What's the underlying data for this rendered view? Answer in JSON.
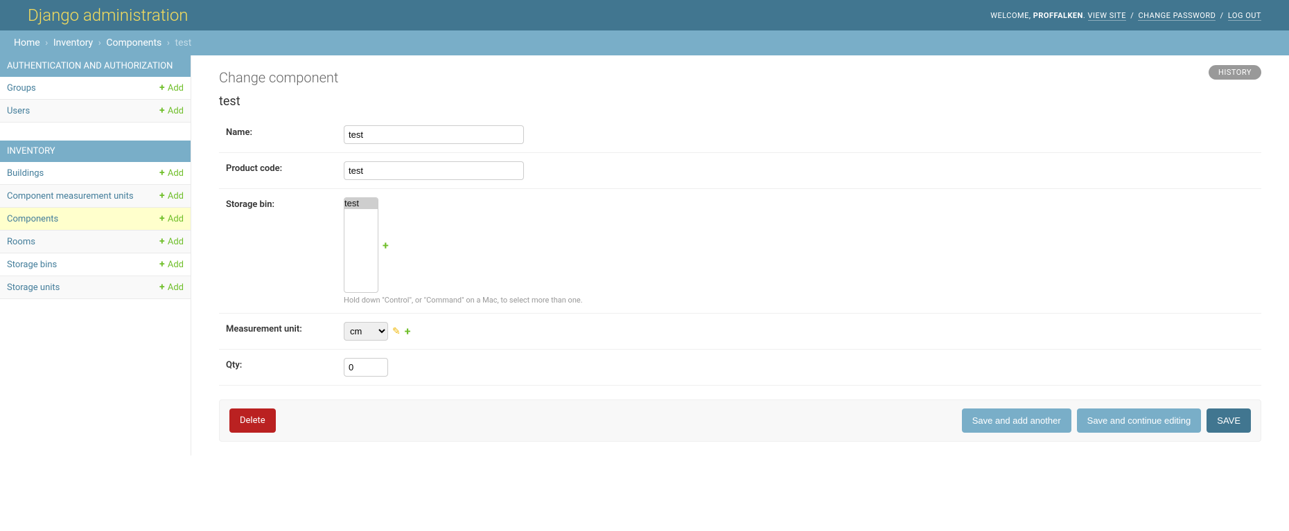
{
  "branding": "Django administration",
  "user_tools": {
    "welcome": "WELCOME,",
    "username": "PROFFALKEN",
    "view_site": "VIEW SITE",
    "change_password": "CHANGE PASSWORD",
    "log_out": "LOG OUT"
  },
  "breadcrumbs": {
    "home": "Home",
    "app": "Inventory",
    "model": "Components",
    "object": "test"
  },
  "sidebar": {
    "apps": [
      {
        "label": "AUTHENTICATION AND AUTHORIZATION",
        "models": [
          {
            "name": "Groups",
            "add": "Add"
          },
          {
            "name": "Users",
            "add": "Add"
          }
        ]
      },
      {
        "label": "INVENTORY",
        "models": [
          {
            "name": "Buildings",
            "add": "Add"
          },
          {
            "name": "Component measurement units",
            "add": "Add"
          },
          {
            "name": "Components",
            "add": "Add",
            "current": true
          },
          {
            "name": "Rooms",
            "add": "Add"
          },
          {
            "name": "Storage bins",
            "add": "Add"
          },
          {
            "name": "Storage units",
            "add": "Add"
          }
        ]
      }
    ]
  },
  "content": {
    "title": "Change component",
    "history": "HISTORY",
    "object_name": "test",
    "fields": {
      "name_label": "Name:",
      "name_value": "test",
      "product_code_label": "Product code:",
      "product_code_value": "test",
      "storage_bin_label": "Storage bin:",
      "storage_bin_options": [
        "test"
      ],
      "storage_bin_help": "Hold down \"Control\", or \"Command\" on a Mac, to select more than one.",
      "measurement_unit_label": "Measurement unit:",
      "measurement_unit_value": "cm",
      "qty_label": "Qty:",
      "qty_value": "0"
    },
    "actions": {
      "delete": "Delete",
      "save_add_another": "Save and add another",
      "save_continue": "Save and continue editing",
      "save": "SAVE"
    }
  }
}
